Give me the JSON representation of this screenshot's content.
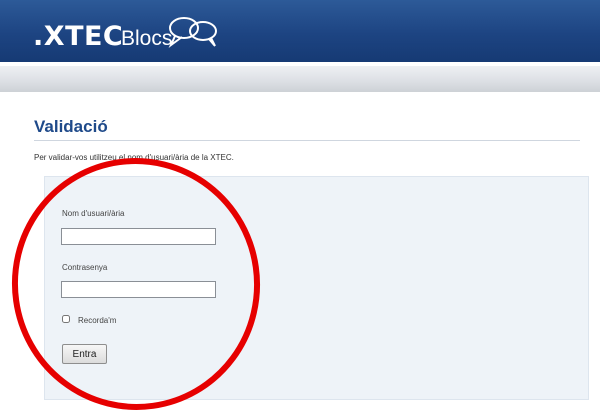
{
  "header": {
    "logo_text": ".XTEC",
    "logo_suffix": "Blocs",
    "bubble_icon": "speech-bubbles-icon",
    "colors": {
      "header_blue": "#1d4482",
      "title_blue": "#1f4a8a"
    }
  },
  "page": {
    "title": "Validació",
    "intro": "Per validar-vos utilitzeu el nom d'usuari/ària de la XTEC."
  },
  "form": {
    "username_label": "Nom d'usuari/ària",
    "username_value": "",
    "password_label": "Contrasenya",
    "password_value": "",
    "remember_label": "Recorda'm",
    "remember_checked": false,
    "submit_label": "Entra"
  },
  "annotation": {
    "shape": "hand-drawn-circle",
    "color": "#e60000"
  }
}
